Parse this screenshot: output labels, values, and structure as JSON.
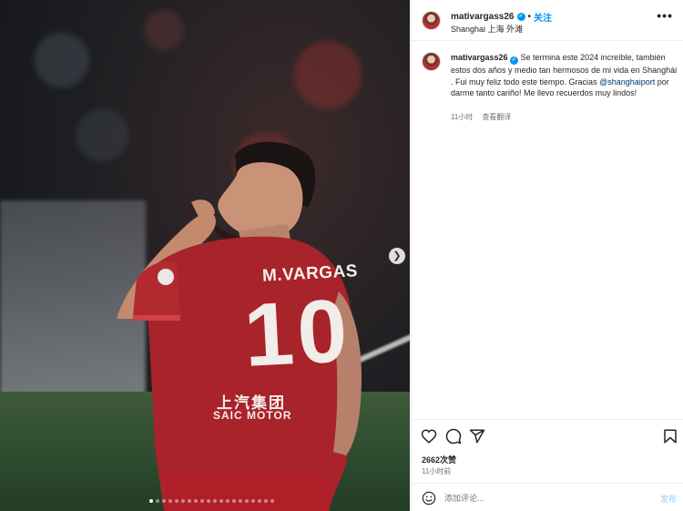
{
  "post": {
    "username": "mativargass26",
    "follow_label": "关注",
    "separator": "•",
    "location": "Shanghai 上海 外滩",
    "more_label": "•••",
    "caption_text": " Se termina este 2024 increíble, también estos dos años y medio tan hermosos de mi vida en Shanghái . Fui muy feliz todo este tiempo. Gracias ",
    "mention": "@shanghaiport",
    "caption_text_end": " por darme tanto cariño! Me llevo recuerdos muy lindos!",
    "caption_time": "11小时",
    "translate_label": "查看翻译",
    "likes": "2662次赞",
    "post_time": "11小时前",
    "jersey_name": "M.VARGAS",
    "jersey_number": "10",
    "sponsor_cn": "上汽集团",
    "sponsor_en": "SAIC MOTOR"
  },
  "carousel": {
    "next_icon": "chevron-right-icon",
    "dot_count": 20,
    "active_index": 0
  },
  "actions": {
    "icons": [
      "heart-icon",
      "comment-icon",
      "share-icon",
      "bookmark-icon"
    ]
  },
  "comment": {
    "placeholder": "添加评论...",
    "post_label": "发布"
  },
  "colors": {
    "accent": "#0095f6",
    "jersey": "#a9232a",
    "mention": "#00376b"
  }
}
